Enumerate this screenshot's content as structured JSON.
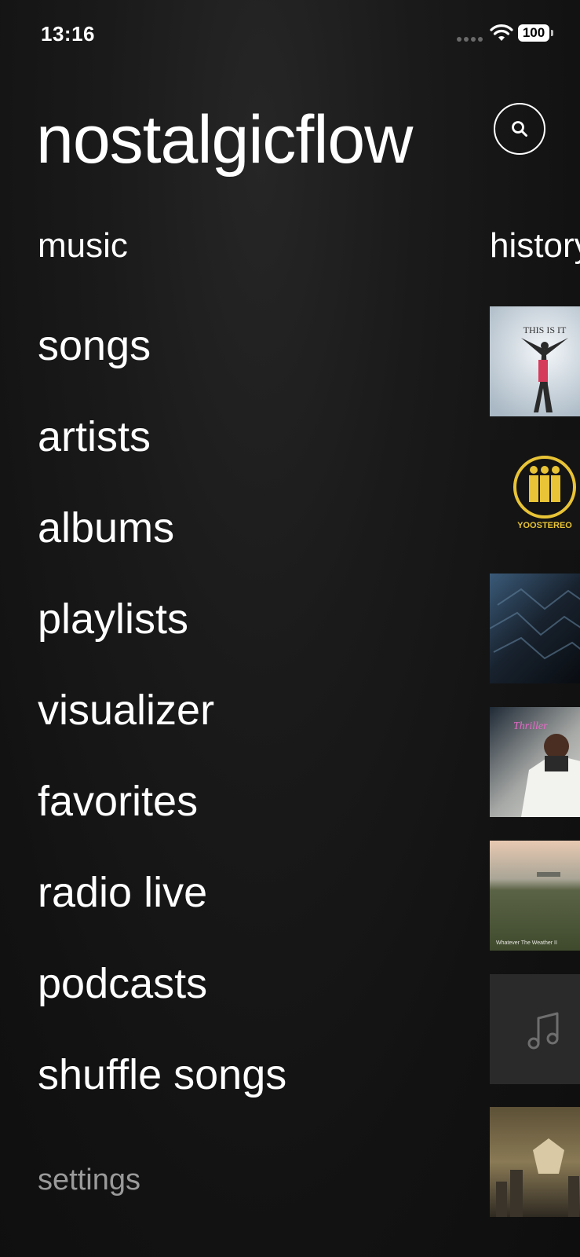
{
  "status_bar": {
    "time": "13:16",
    "battery": "100"
  },
  "app": {
    "title": "nostalgicflow"
  },
  "sections": {
    "music": "music",
    "history": "history"
  },
  "menu": {
    "items": [
      {
        "label": "songs"
      },
      {
        "label": "artists"
      },
      {
        "label": "albums"
      },
      {
        "label": "playlists"
      },
      {
        "label": "visualizer"
      },
      {
        "label": "favorites"
      },
      {
        "label": "radio live"
      },
      {
        "label": "podcasts"
      },
      {
        "label": "shuffle songs"
      }
    ],
    "settings": "settings"
  },
  "history": {
    "items": [
      {
        "caption": "THIS IS IT"
      },
      {
        "caption": "YOOSTEREO"
      },
      {
        "caption": ""
      },
      {
        "caption": "Thriller"
      },
      {
        "caption": "Whatever The Weather II"
      },
      {
        "caption": "",
        "icon": "music-note-icon"
      },
      {
        "caption": ""
      }
    ]
  },
  "colors": {
    "background": "#121212",
    "text": "#ffffff",
    "muted_text": "#9a9a9a",
    "placeholder_tile": "#2a2a2a"
  }
}
